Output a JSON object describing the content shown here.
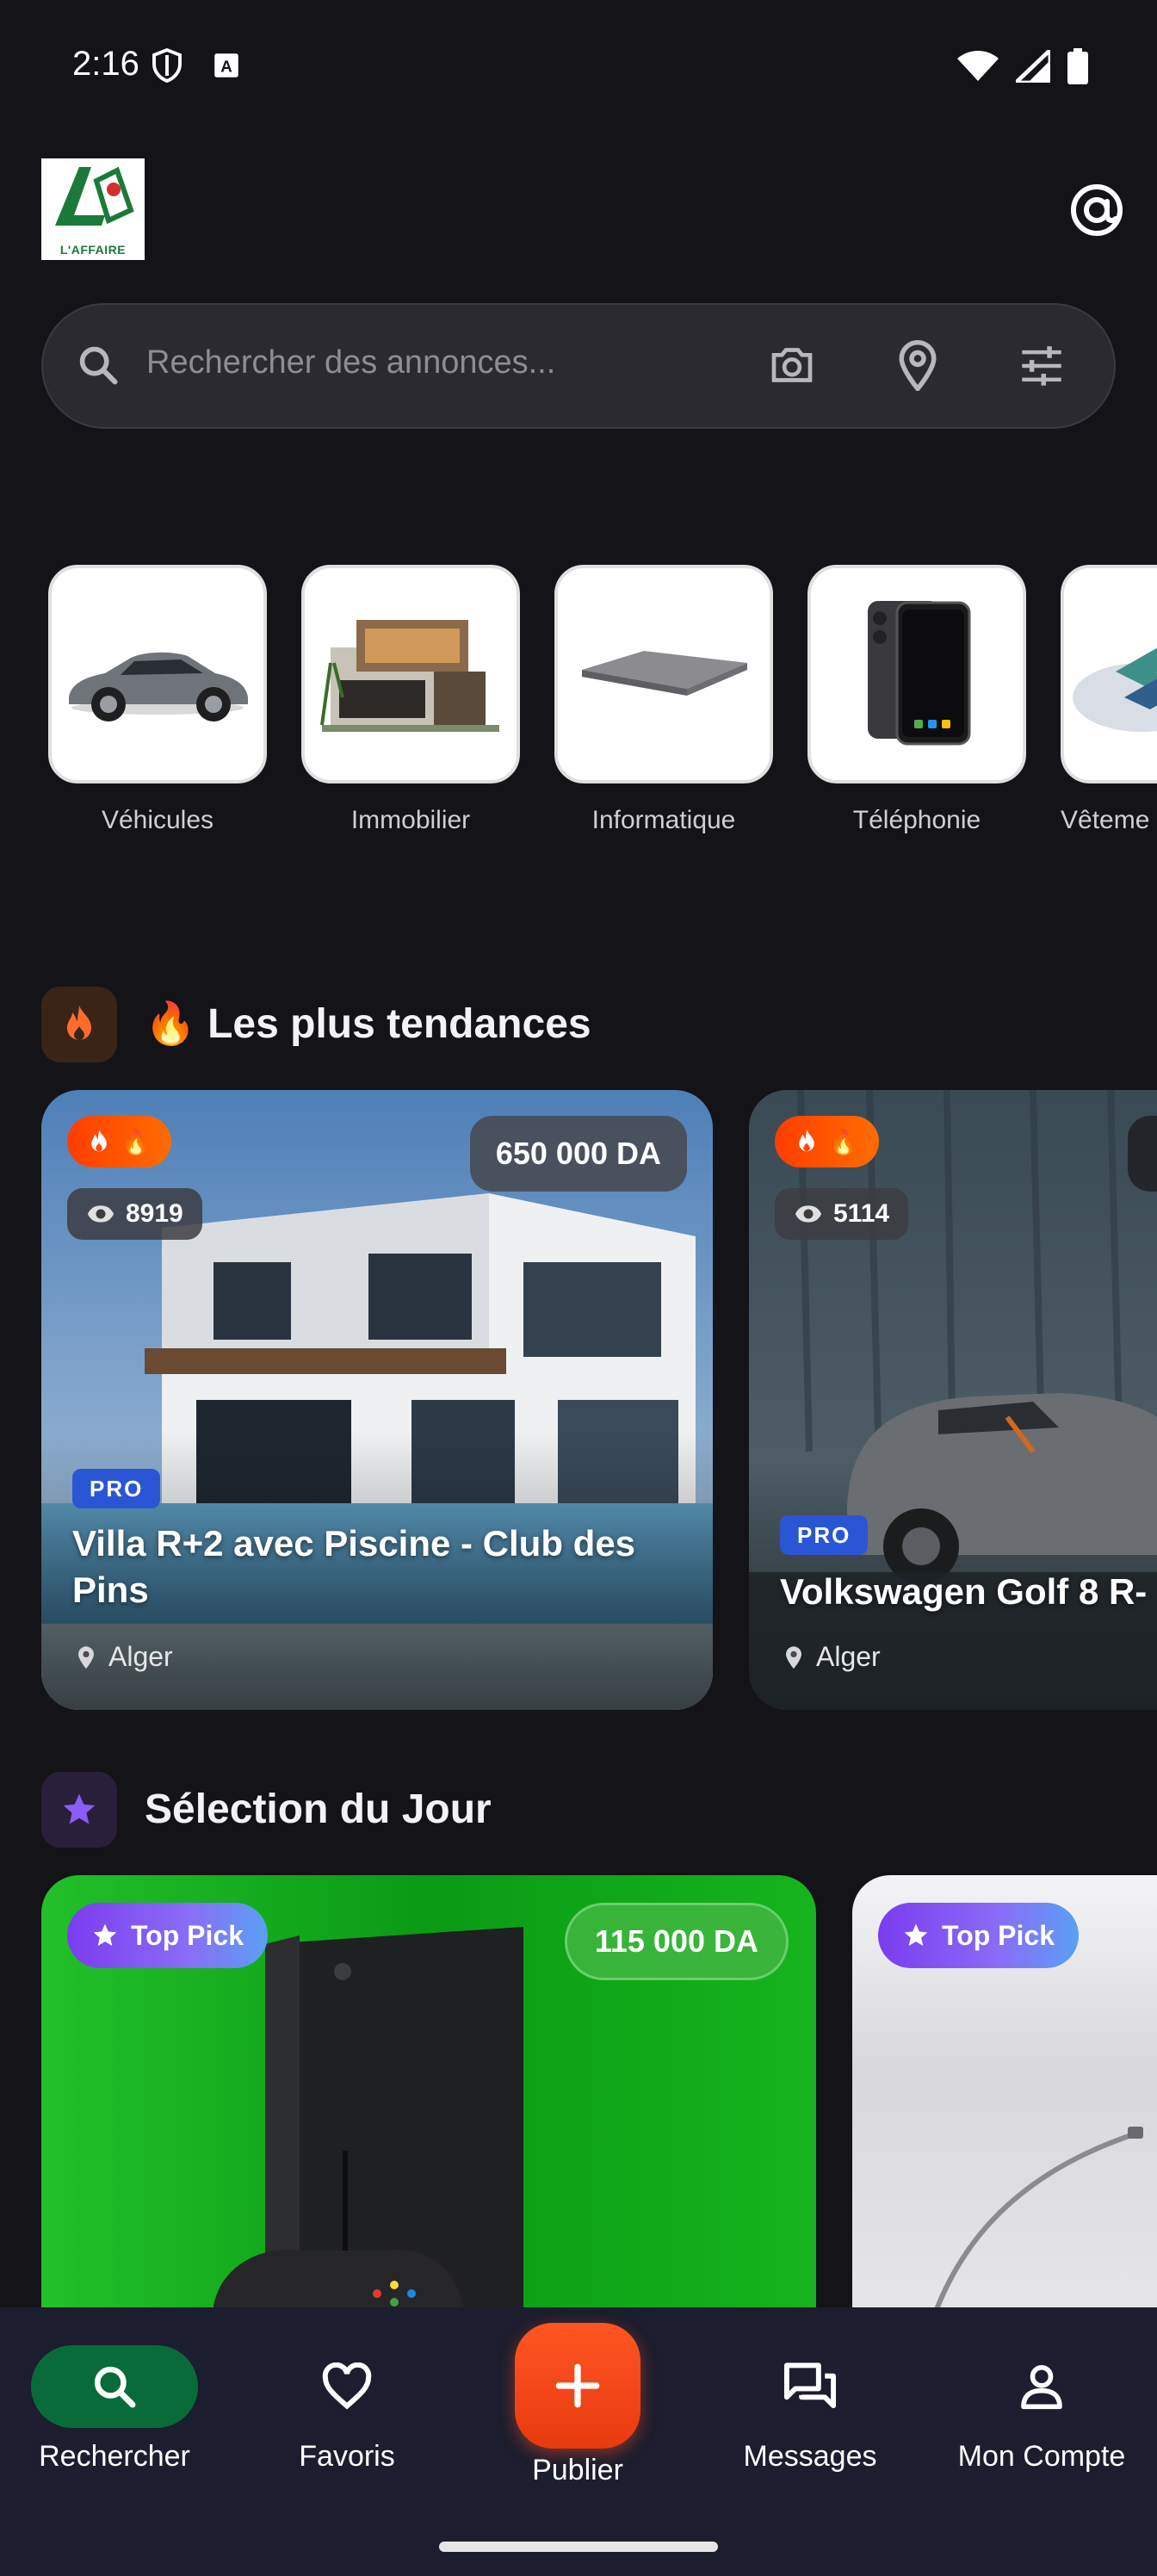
{
  "status_bar": {
    "time": "2:16"
  },
  "header": {
    "logo_text": "L'AFFAIRE"
  },
  "search": {
    "placeholder": "Rechercher des annonces..."
  },
  "categories": [
    {
      "label": "Véhicules"
    },
    {
      "label": "Immobilier"
    },
    {
      "label": "Informatique"
    },
    {
      "label": "Téléphonie"
    },
    {
      "label": "Vêteme"
    }
  ],
  "trending": {
    "title": "🔥 Les plus tendances",
    "cards": [
      {
        "fire": "🔥",
        "views": "8919",
        "price": "650 000 DA",
        "pro": "PRO",
        "title": "Villa R+2 avec Piscine - Club des Pins",
        "location": "Alger"
      },
      {
        "fire": "🔥",
        "views": "5114",
        "pro": "PRO",
        "title": "Volkswagen Golf 8 R-",
        "location": "Alger"
      }
    ]
  },
  "selection": {
    "title": "Sélection du Jour",
    "cards": [
      {
        "badge": "Top Pick",
        "price": "115 000 DA"
      },
      {
        "badge": "Top Pick"
      }
    ]
  },
  "bottom_nav": {
    "search": "Rechercher",
    "favorites": "Favoris",
    "publish": "Publier",
    "messages": "Messages",
    "account": "Mon Compte"
  },
  "colors": {
    "background": "#141318",
    "accent_green": "#0a6b3a",
    "accent_orange": "#ff5522",
    "pro_blue": "#2a56d6",
    "top_pick_purple": "#7b3cf0"
  }
}
